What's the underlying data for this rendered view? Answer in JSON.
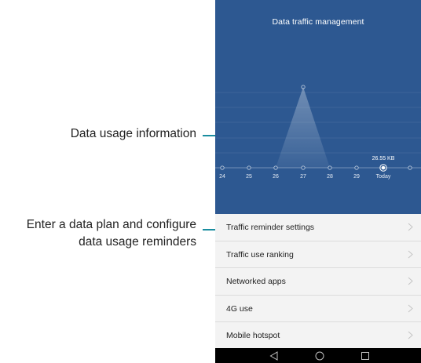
{
  "callouts": {
    "data_usage": "Data usage information",
    "data_plan_line1": "Enter a data plan and configure",
    "data_plan_line2": "data usage reminders"
  },
  "screen": {
    "title": "Data traffic management",
    "menu": [
      {
        "label": "Traffic reminder settings"
      },
      {
        "label": "Traffic use ranking"
      },
      {
        "label": "Networked apps"
      },
      {
        "label": "4G use"
      },
      {
        "label": "Mobile hotspot"
      }
    ],
    "nav": {
      "back": "back-icon",
      "home": "home-icon",
      "recents": "recents-icon"
    }
  },
  "colors": {
    "hero_bg": "#2d5891",
    "callout_line": "#1a8da0",
    "menu_bg": "#f3f3f3"
  },
  "chart_data": {
    "type": "area",
    "categories": [
      "24",
      "25",
      "26",
      "27",
      "28",
      "29",
      "Today"
    ],
    "highlight": {
      "category": "Today",
      "label": "26.55 KB"
    }
  }
}
